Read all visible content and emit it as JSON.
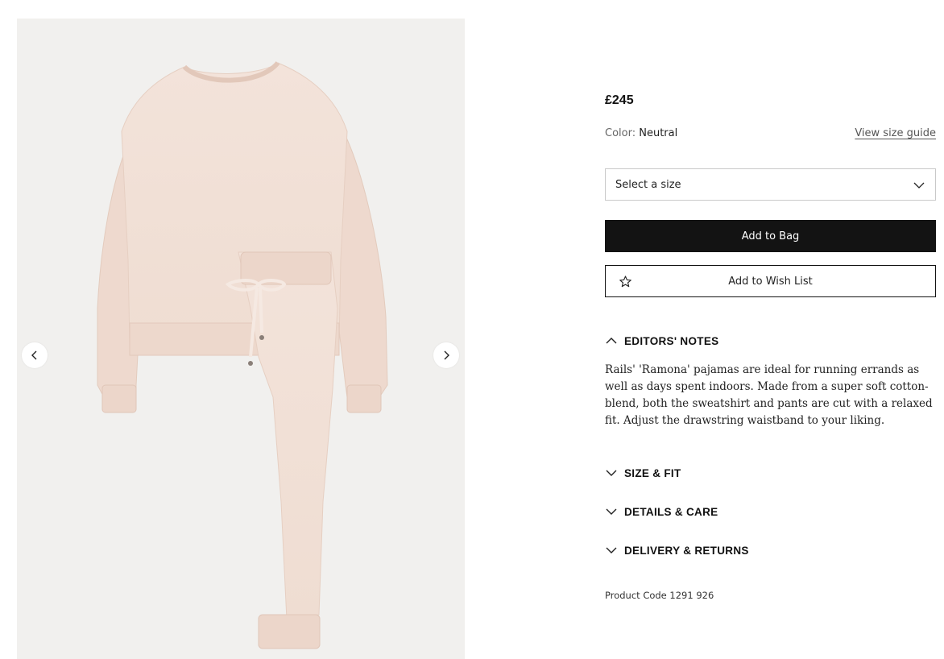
{
  "gallery": {
    "prev_icon": "chevron-left-icon",
    "next_icon": "chevron-right-icon"
  },
  "product": {
    "price": "£245",
    "color_label": "Color:",
    "color_value": "Neutral",
    "size_guide_link": "View size guide",
    "size_select": {
      "placeholder": "Select a size",
      "icon": "chevron-down-icon"
    },
    "add_to_bag": "Add to Bag",
    "wishlist": {
      "label": "Add to Wish List",
      "icon": "star-icon"
    },
    "code_label": "Product Code",
    "code_value": "1291 926"
  },
  "accordion": [
    {
      "title": "EDITORS' NOTES",
      "expanded": true,
      "body": "Rails' 'Ramona' pajamas are ideal for running errands as well as days spent indoors. Made from a super soft cotton-blend, both the sweatshirt and pants are cut with a relaxed fit. Adjust the drawstring waistband to your liking."
    },
    {
      "title": "SIZE & FIT",
      "expanded": false
    },
    {
      "title": "DETAILS & CARE",
      "expanded": false
    },
    {
      "title": "DELIVERY & RETURNS",
      "expanded": false
    }
  ],
  "colors": {
    "button_dark": "#131313",
    "image_background": "#f1f0ee",
    "garment": "#f1dfd5"
  }
}
